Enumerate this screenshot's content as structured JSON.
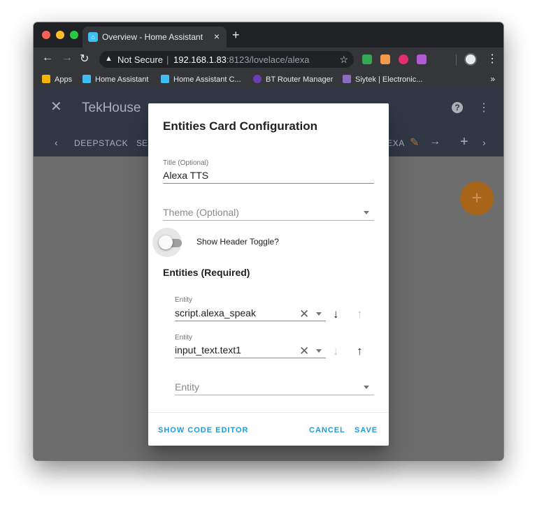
{
  "browser": {
    "tab": {
      "title": "Overview - Home Assistant",
      "close_glyph": "×"
    },
    "new_tab_glyph": "+",
    "address": {
      "security_label": "Not Secure",
      "host": "192.168.1.83",
      "rest": ":8123/lovelace/alexa"
    },
    "bookmarks": [
      {
        "label": "Apps",
        "color": "#f4b400"
      },
      {
        "label": "Home Assistant",
        "color": "#41bdf5"
      },
      {
        "label": "Home Assistant C...",
        "color": "#41bdf5"
      },
      {
        "label": "BT Router Manager",
        "color": "#6a3fb5"
      },
      {
        "label": "Siytek | Electronic...",
        "color": "#8e6cc4"
      }
    ],
    "bookmarks_more": "»"
  },
  "ha": {
    "title": "TekHouse",
    "tabs": {
      "first": "DEEPSTACK",
      "second": "SE",
      "active": "EXA"
    },
    "accent": "#a8651a"
  },
  "dialog": {
    "title": "Entities Card Configuration",
    "title_field": {
      "label": "Title (Optional)",
      "value": "Alexa TTS"
    },
    "theme_field": {
      "placeholder": "Theme (Optional)"
    },
    "header_toggle": {
      "label": "Show Header Toggle?",
      "checked": false
    },
    "entities_heading": "Entities (Required)",
    "entities": [
      {
        "label": "Entity",
        "value": "script.alexa_speak",
        "down_enabled": true,
        "up_enabled": false
      },
      {
        "label": "Entity",
        "value": "input_text.text1",
        "down_enabled": false,
        "up_enabled": true
      }
    ],
    "new_entity": {
      "placeholder": "Entity"
    },
    "buttons": {
      "code_editor": "SHOW CODE EDITOR",
      "cancel": "CANCEL",
      "save": "SAVE"
    },
    "button_color": "#1e9bd6"
  }
}
